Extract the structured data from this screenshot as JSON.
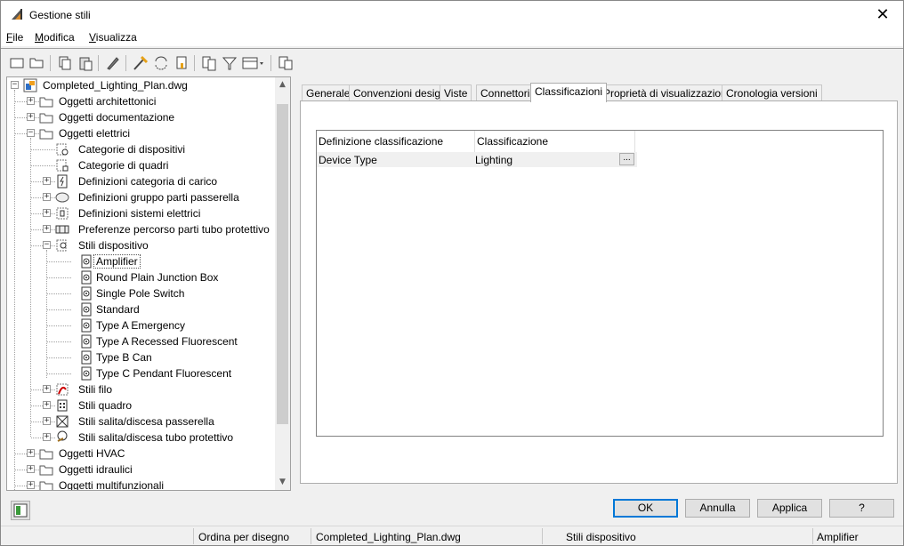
{
  "window": {
    "title": "Gestione stili"
  },
  "menu": {
    "items": [
      "File",
      "Modifica",
      "Visualizza"
    ]
  },
  "toolbar": {
    "buttons": [
      "new-icon",
      "open-icon",
      "copy-icon",
      "paste-icon",
      "edit-icon",
      "purge-icon",
      "cycle-icon",
      "flag-icon",
      "compare-icon",
      "filter-icon",
      "view-dropdown-icon",
      "toggle-view-icon"
    ]
  },
  "tree": {
    "root": "Completed_Lighting_Plan.dwg",
    "items": [
      {
        "label": "Oggetti architettonici",
        "level": 1,
        "expander": "+",
        "icon": "folder-icon"
      },
      {
        "label": "Oggetti documentazione",
        "level": 1,
        "expander": "+",
        "icon": "folder-icon"
      },
      {
        "label": "Oggetti elettrici",
        "level": 1,
        "expander": "-",
        "icon": "folder-icon"
      },
      {
        "label": "Categorie di dispositivi",
        "level": 2,
        "expander": "",
        "icon": "device-category-icon"
      },
      {
        "label": "Categorie di quadri",
        "level": 2,
        "expander": "",
        "icon": "panel-category-icon"
      },
      {
        "label": "Definizioni categoria di carico",
        "level": 2,
        "expander": "+",
        "icon": "load-category-icon"
      },
      {
        "label": "Definizioni gruppo parti passerella",
        "level": 2,
        "expander": "+",
        "icon": "cable-tray-group-icon"
      },
      {
        "label": "Definizioni sistemi elettrici",
        "level": 2,
        "expander": "+",
        "icon": "electrical-system-icon"
      },
      {
        "label": "Preferenze percorso parti tubo protettivo",
        "level": 2,
        "expander": "+",
        "icon": "conduit-routing-icon"
      },
      {
        "label": "Stili dispositivo",
        "level": 2,
        "expander": "-",
        "icon": "device-style-icon"
      },
      {
        "label": "Amplifier",
        "level": 3,
        "expander": "",
        "icon": "device-icon",
        "selected": true
      },
      {
        "label": "Round Plain Junction Box",
        "level": 3,
        "expander": "",
        "icon": "device-icon"
      },
      {
        "label": "Single Pole Switch",
        "level": 3,
        "expander": "",
        "icon": "device-icon"
      },
      {
        "label": "Standard",
        "level": 3,
        "expander": "",
        "icon": "device-icon"
      },
      {
        "label": "Type A Emergency",
        "level": 3,
        "expander": "",
        "icon": "device-icon"
      },
      {
        "label": "Type A Recessed Fluorescent",
        "level": 3,
        "expander": "",
        "icon": "device-icon"
      },
      {
        "label": "Type B Can",
        "level": 3,
        "expander": "",
        "icon": "device-icon"
      },
      {
        "label": "Type C Pendant Fluorescent",
        "level": 3,
        "expander": "",
        "icon": "device-icon"
      },
      {
        "label": "Stili filo",
        "level": 2,
        "expander": "+",
        "icon": "wire-style-icon"
      },
      {
        "label": "Stili quadro",
        "level": 2,
        "expander": "+",
        "icon": "panel-style-icon"
      },
      {
        "label": "Stili salita/discesa passerella",
        "level": 2,
        "expander": "+",
        "icon": "cable-tray-rise-icon"
      },
      {
        "label": "Stili salita/discesa tubo protettivo",
        "level": 2,
        "expander": "+",
        "icon": "conduit-rise-icon"
      },
      {
        "label": "Oggetti HVAC",
        "level": 1,
        "expander": "+",
        "icon": "folder-icon"
      },
      {
        "label": "Oggetti idraulici",
        "level": 1,
        "expander": "+",
        "icon": "folder-icon"
      },
      {
        "label": "Oggetti multifunzionali",
        "level": 1,
        "expander": "+",
        "icon": "folder-icon"
      }
    ]
  },
  "tabs": [
    "Generale",
    "Convenzioni design",
    "Viste",
    "Connettori",
    "Classificazioni",
    "Proprietà di visualizzazione",
    "Cronologia versioni"
  ],
  "active_tab": "Classificazioni",
  "classification_grid": {
    "headers": [
      "Definizione classificazione",
      "Classificazione"
    ],
    "rows": [
      {
        "definition": "Device Type",
        "classification": "Lighting",
        "button": "..."
      }
    ]
  },
  "buttons": {
    "ok": "OK",
    "cancel": "Annulla",
    "apply": "Applica",
    "help": "?"
  },
  "status": {
    "sort": "Ordina per disegno",
    "drawing": "Completed_Lighting_Plan.dwg",
    "category": "Stili dispositivo",
    "style": "Amplifier"
  }
}
